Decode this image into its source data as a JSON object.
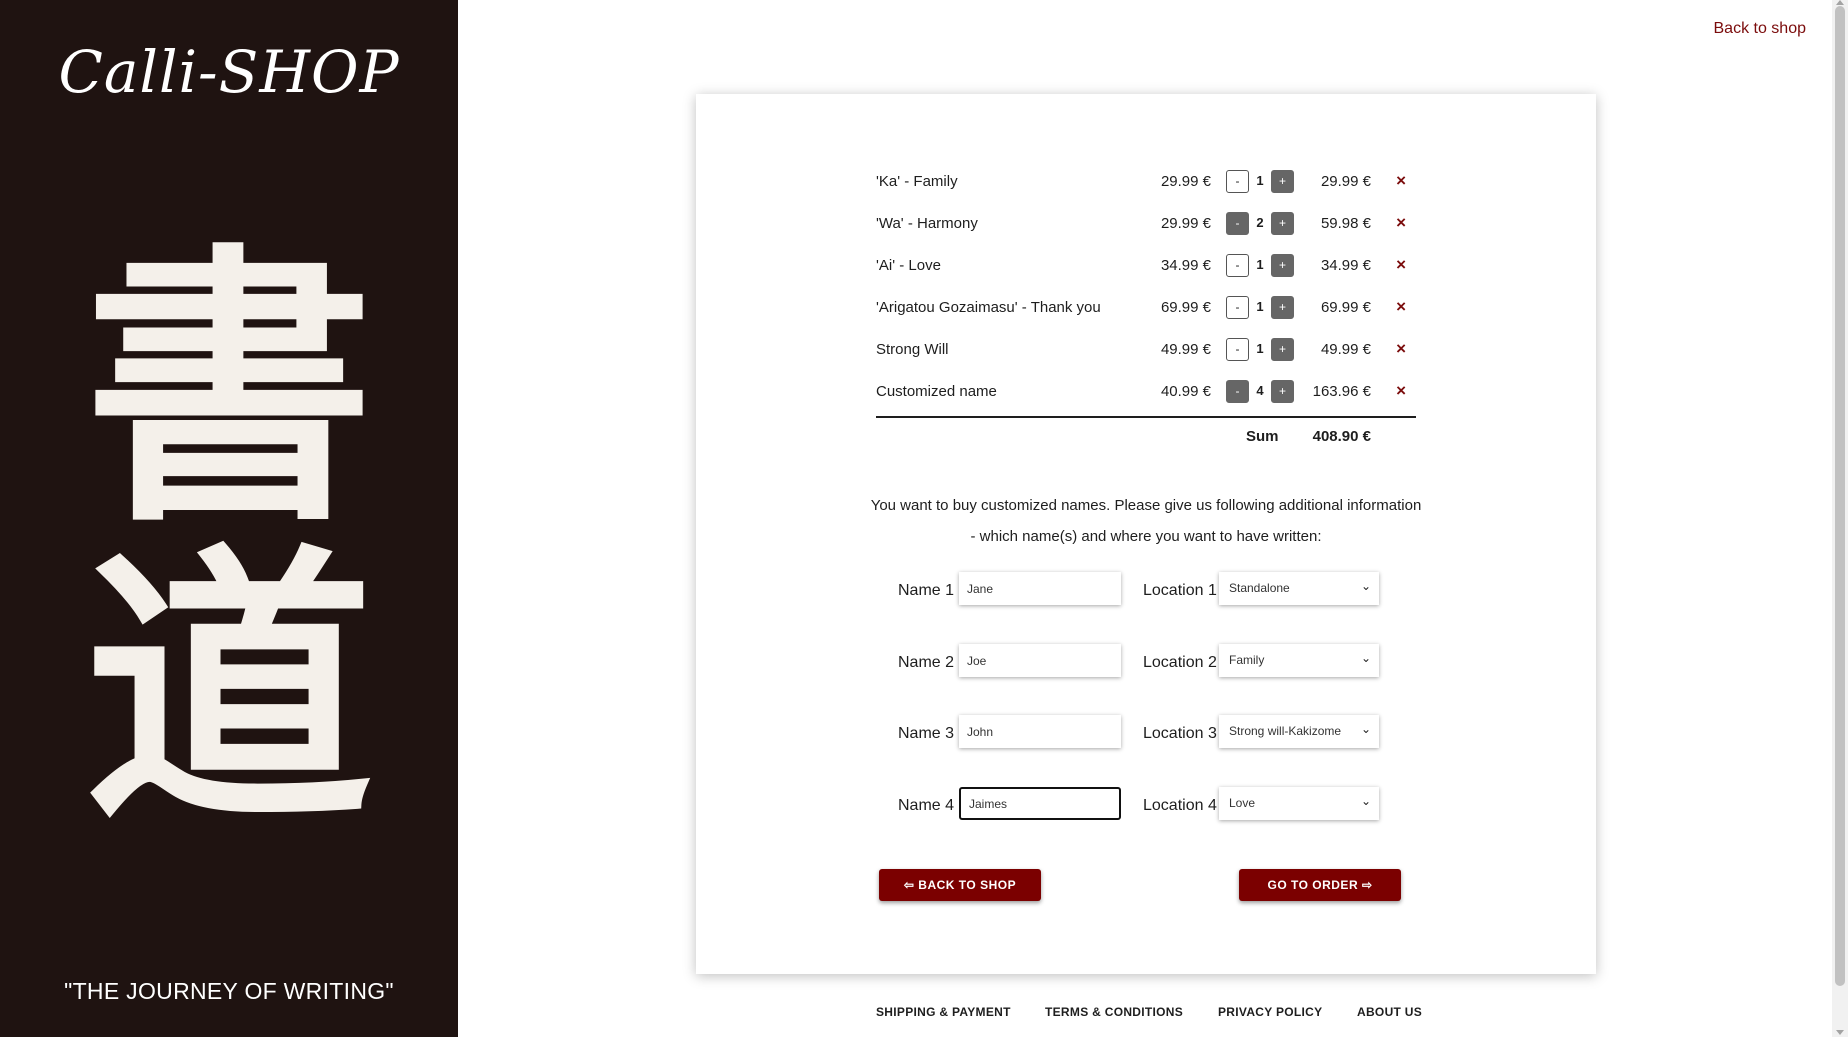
{
  "sidebar": {
    "logo": "Calli-SHOP",
    "kanji_top": "書",
    "kanji_bottom": "道",
    "tagline": "\"THE JOURNEY OF WRITING\""
  },
  "header": {
    "back_link": "Back to shop"
  },
  "cart": {
    "items": [
      {
        "name": "'Ka' - Family",
        "price": "29.99 €",
        "qty": "1",
        "total": "29.99 €"
      },
      {
        "name": "'Wa' - Harmony",
        "price": "29.99 €",
        "qty": "2",
        "total": "59.98 €"
      },
      {
        "name": "'Ai' - Love",
        "price": "34.99 €",
        "qty": "1",
        "total": "34.99 €"
      },
      {
        "name": "'Arigatou Gozaimasu' - Thank you",
        "price": "69.99 €",
        "qty": "1",
        "total": "69.99 €"
      },
      {
        "name": "Strong Will",
        "price": "49.99 €",
        "qty": "1",
        "total": "49.99 €"
      },
      {
        "name": "Customized name",
        "price": "40.99 €",
        "qty": "4",
        "total": "163.96 €"
      }
    ],
    "minus_label": "-",
    "plus_label": "+",
    "remove_label": "×",
    "sum_label": "Sum",
    "sum_value": "408.90 €"
  },
  "info": {
    "line1": "You want to buy customized names. Please give us following additional information",
    "line2": "- which name(s) and where you want to have written:"
  },
  "custom_names": [
    {
      "name_label": "Name 1",
      "name_value": "Jane",
      "location_label": "Location 1",
      "location_value": "Standalone"
    },
    {
      "name_label": "Name 2",
      "name_value": "Joe",
      "location_label": "Location 2",
      "location_value": "Family"
    },
    {
      "name_label": "Name 3",
      "name_value": "John",
      "location_label": "Location 3",
      "location_value": "Strong will-Kakizome"
    },
    {
      "name_label": "Name 4",
      "name_value": "Jaimes",
      "location_label": "Location 4",
      "location_value": "Love"
    }
  ],
  "buttons": {
    "back": "⇦ BACK TO SHOP",
    "order": "GO TO ORDER ⇨"
  },
  "footer": {
    "links": [
      "SHIPPING & PAYMENT",
      "TERMS & CONDITIONS",
      "PRIVACY POLICY",
      "ABOUT US"
    ]
  },
  "colors": {
    "sidebar_bg": "#1f1311",
    "accent": "#7b0000",
    "link": "#7b0c0c"
  }
}
